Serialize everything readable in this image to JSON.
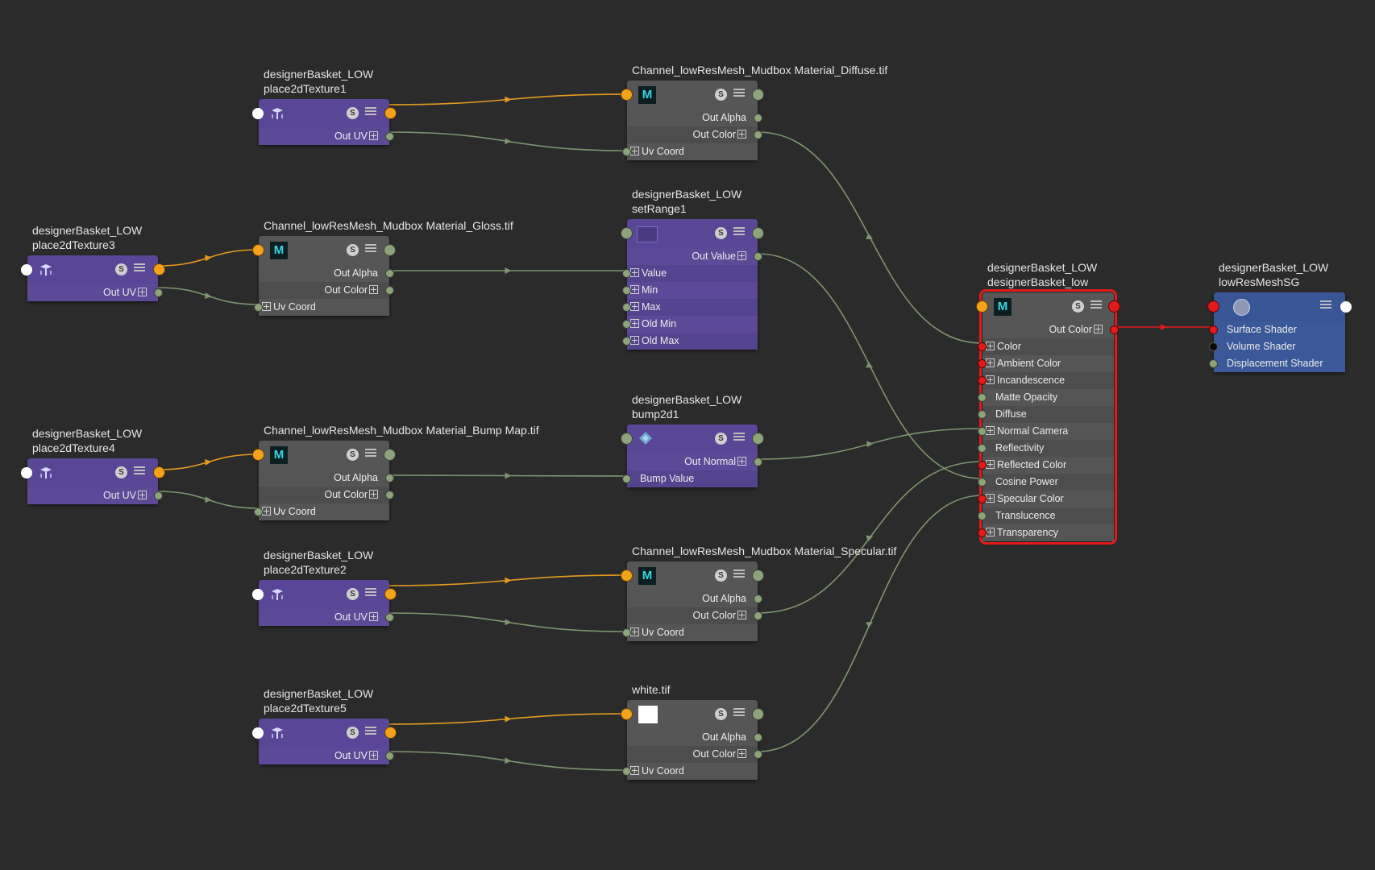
{
  "nodes": {
    "p2d1": {
      "title1": "designerBasket_LOW",
      "title2": "place2dTexture1",
      "out_uv": "Out UV"
    },
    "p2d3": {
      "title1": "designerBasket_LOW",
      "title2": "place2dTexture3",
      "out_uv": "Out UV"
    },
    "p2d4": {
      "title1": "designerBasket_LOW",
      "title2": "place2dTexture4",
      "out_uv": "Out UV"
    },
    "p2d2": {
      "title1": "designerBasket_LOW",
      "title2": "place2dTexture2",
      "out_uv": "Out UV"
    },
    "p2d5": {
      "title1": "designerBasket_LOW",
      "title2": "place2dTexture5",
      "out_uv": "Out UV"
    },
    "diffuse": {
      "title": "Channel_lowResMesh_Mudbox Material_Diffuse.tif",
      "icon": "M",
      "out_alpha": "Out Alpha",
      "out_color": "Out Color",
      "uv_coord": "Uv Coord"
    },
    "gloss": {
      "title": "Channel_lowResMesh_Mudbox Material_Gloss.tif",
      "icon": "M",
      "out_alpha": "Out Alpha",
      "out_color": "Out Color",
      "uv_coord": "Uv Coord"
    },
    "bumpmap": {
      "title": "Channel_lowResMesh_Mudbox Material_Bump Map.tif",
      "icon": "M",
      "out_alpha": "Out Alpha",
      "out_color": "Out Color",
      "uv_coord": "Uv Coord"
    },
    "specular": {
      "title": "Channel_lowResMesh_Mudbox Material_Specular.tif",
      "icon": "M",
      "out_alpha": "Out Alpha",
      "out_color": "Out Color",
      "uv_coord": "Uv Coord"
    },
    "white": {
      "title": "white.tif",
      "out_alpha": "Out Alpha",
      "out_color": "Out Color",
      "uv_coord": "Uv Coord"
    },
    "setrange": {
      "title1": "designerBasket_LOW",
      "title2": "setRange1",
      "out_value": "Out Value",
      "inputs": [
        "Value",
        "Min",
        "Max",
        "Old Min",
        "Old Max"
      ]
    },
    "bump2d": {
      "title1": "designerBasket_LOW",
      "title2": "bump2d1",
      "out_normal": "Out Normal",
      "bump_value": "Bump Value"
    },
    "material": {
      "title1": "designerBasket_LOW",
      "title2": "designerBasket_low",
      "icon": "M",
      "out_color": "Out Color",
      "inputs": [
        "Color",
        "Ambient Color",
        "Incandescence",
        "Matte Opacity",
        "Diffuse",
        "Normal Camera",
        "Reflectivity",
        "Reflected Color",
        "Cosine Power",
        "Specular Color",
        "Translucence",
        "Transparency"
      ]
    },
    "sg": {
      "title1": "designerBasket_LOW",
      "title2": "lowResMeshSG",
      "inputs": [
        "Surface Shader",
        "Volume Shader",
        "Displacement Shader"
      ]
    }
  },
  "colors": {
    "background": "#2b2b2b",
    "wire_uv": "#e59a1e",
    "wire_data": "#7e9470",
    "wire_selected": "#e11a1a",
    "selection": "#e11a1a"
  }
}
